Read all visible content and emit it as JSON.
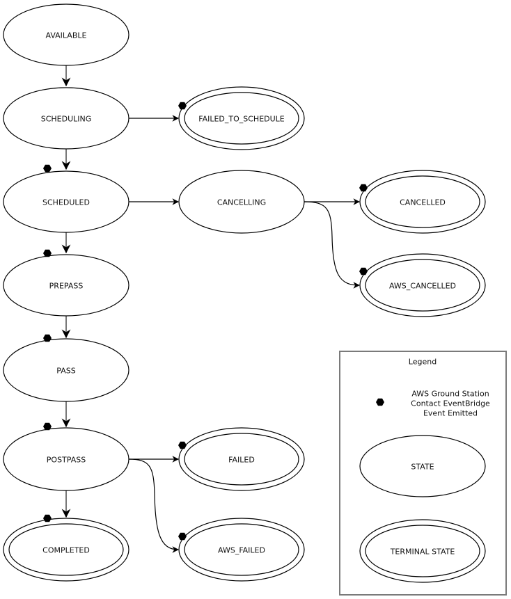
{
  "diagram": {
    "type": "state-machine",
    "event_color": "#e7157b",
    "states": [
      {
        "id": "available",
        "label": "AVAILABLE",
        "terminal": false,
        "event": false
      },
      {
        "id": "scheduling",
        "label": "SCHEDULING",
        "terminal": false,
        "event": false
      },
      {
        "id": "scheduled",
        "label": "SCHEDULED",
        "terminal": false,
        "event": true
      },
      {
        "id": "prepass",
        "label": "PREPASS",
        "terminal": false,
        "event": true
      },
      {
        "id": "pass",
        "label": "PASS",
        "terminal": false,
        "event": true
      },
      {
        "id": "postpass",
        "label": "POSTPASS",
        "terminal": false,
        "event": true
      },
      {
        "id": "completed",
        "label": "COMPLETED",
        "terminal": true,
        "event": true
      },
      {
        "id": "failed_to_schedule",
        "label": "FAILED_TO_SCHEDULE",
        "terminal": true,
        "event": true
      },
      {
        "id": "cancelling",
        "label": "CANCELLING",
        "terminal": false,
        "event": false
      },
      {
        "id": "cancelled",
        "label": "CANCELLED",
        "terminal": true,
        "event": true
      },
      {
        "id": "aws_cancelled",
        "label": "AWS_CANCELLED",
        "terminal": true,
        "event": true
      },
      {
        "id": "failed",
        "label": "FAILED",
        "terminal": true,
        "event": true
      },
      {
        "id": "aws_failed",
        "label": "AWS_FAILED",
        "terminal": true,
        "event": true
      }
    ],
    "transitions": [
      {
        "from": "available",
        "to": "scheduling"
      },
      {
        "from": "scheduling",
        "to": "scheduled"
      },
      {
        "from": "scheduling",
        "to": "failed_to_schedule"
      },
      {
        "from": "scheduled",
        "to": "prepass"
      },
      {
        "from": "scheduled",
        "to": "cancelling"
      },
      {
        "from": "cancelling",
        "to": "cancelled"
      },
      {
        "from": "cancelling",
        "to": "aws_cancelled"
      },
      {
        "from": "prepass",
        "to": "pass"
      },
      {
        "from": "pass",
        "to": "postpass"
      },
      {
        "from": "postpass",
        "to": "completed"
      },
      {
        "from": "postpass",
        "to": "failed"
      },
      {
        "from": "postpass",
        "to": "aws_failed"
      }
    ]
  },
  "legend": {
    "title": "Legend",
    "event_line1": "AWS Ground Station",
    "event_line2": "Contact EventBridge",
    "event_line3": "Event Emitted",
    "event_icon": "event-burst-icon",
    "state_label": "STATE",
    "terminal_state_label": "TERMINAL STATE"
  }
}
